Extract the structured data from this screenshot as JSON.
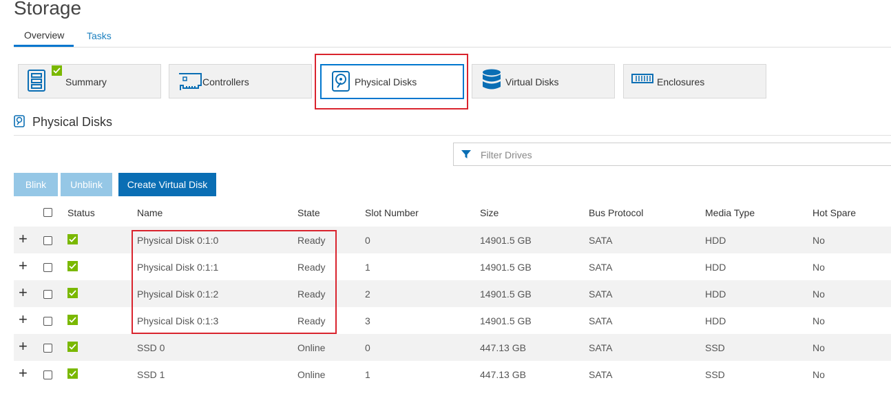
{
  "page": {
    "title": "Storage"
  },
  "tabs": [
    {
      "label": "Overview",
      "active": true
    },
    {
      "label": "Tasks",
      "active": false
    }
  ],
  "cards": [
    {
      "label": "Summary",
      "icon": "server-summary-icon",
      "badge": "check"
    },
    {
      "label": "Controllers",
      "icon": "controller-card-icon"
    },
    {
      "label": "Physical Disks",
      "icon": "physical-disk-icon",
      "active": true
    },
    {
      "label": "Virtual Disks",
      "icon": "database-icon"
    },
    {
      "label": "Enclosures",
      "icon": "enclosure-icon"
    }
  ],
  "section": {
    "title": "Physical Disks",
    "icon": "physical-disk-icon"
  },
  "filter": {
    "placeholder": "Filter Drives",
    "icon": "filter-icon"
  },
  "buttons": {
    "blink": "Blink",
    "unblink": "Unblink",
    "create": "Create Virtual Disk"
  },
  "table": {
    "columns": [
      "Status",
      "Name",
      "State",
      "Slot Number",
      "Size",
      "Bus Protocol",
      "Media Type",
      "Hot Spare"
    ],
    "rows": [
      {
        "status": "ok",
        "name": "Physical Disk 0:1:0",
        "state": "Ready",
        "slot": "0",
        "size": "14901.5 GB",
        "bus": "SATA",
        "media": "HDD",
        "hot_spare": "No"
      },
      {
        "status": "ok",
        "name": "Physical Disk 0:1:1",
        "state": "Ready",
        "slot": "1",
        "size": "14901.5 GB",
        "bus": "SATA",
        "media": "HDD",
        "hot_spare": "No"
      },
      {
        "status": "ok",
        "name": "Physical Disk 0:1:2",
        "state": "Ready",
        "slot": "2",
        "size": "14901.5 GB",
        "bus": "SATA",
        "media": "HDD",
        "hot_spare": "No"
      },
      {
        "status": "ok",
        "name": "Physical Disk 0:1:3",
        "state": "Ready",
        "slot": "3",
        "size": "14901.5 GB",
        "bus": "SATA",
        "media": "HDD",
        "hot_spare": "No"
      },
      {
        "status": "ok",
        "name": "SSD 0",
        "state": "Online",
        "slot": "0",
        "size": "447.13 GB",
        "bus": "SATA",
        "media": "SSD",
        "hot_spare": "No"
      },
      {
        "status": "ok",
        "name": "SSD 1",
        "state": "Online",
        "slot": "1",
        "size": "447.13 GB",
        "bus": "SATA",
        "media": "SSD",
        "hot_spare": "No"
      }
    ]
  },
  "colors": {
    "accent": "#0076ce",
    "status_ok": "#7ab800",
    "highlight": "#d9232d"
  }
}
